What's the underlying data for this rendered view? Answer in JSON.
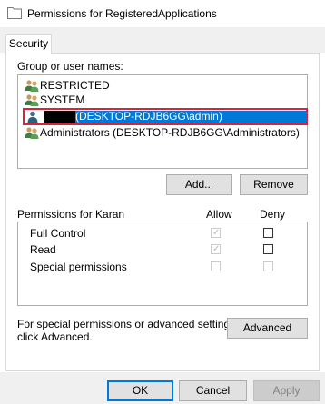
{
  "window": {
    "title": "Permissions for RegisteredApplications"
  },
  "tabs": [
    {
      "label": "Security"
    }
  ],
  "group_section": {
    "label": "Group or user names:",
    "users": [
      {
        "name": "RESTRICTED",
        "icon": "users-icon"
      },
      {
        "name": "SYSTEM",
        "icon": "users-icon"
      },
      {
        "name": "(DESKTOP-RDJB6GG\\admin)",
        "icon": "user-icon",
        "selected": true,
        "name_redacted": true
      },
      {
        "name": "Administrators (DESKTOP-RDJB6GG\\Administrators)",
        "icon": "users-icon"
      }
    ],
    "add_label": "Add...",
    "remove_label": "Remove"
  },
  "permissions_section": {
    "title": "Permissions for Karan",
    "allow_header": "Allow",
    "deny_header": "Deny",
    "rows": [
      {
        "name": "Full Control",
        "allow": true,
        "deny": false,
        "allow_enabled": false,
        "deny_enabled": true
      },
      {
        "name": "Read",
        "allow": true,
        "deny": false,
        "allow_enabled": false,
        "deny_enabled": true
      },
      {
        "name": "Special permissions",
        "allow": false,
        "deny": false,
        "allow_enabled": false,
        "deny_enabled": false
      }
    ]
  },
  "advanced_section": {
    "note_line1": "For special permissions or advanced settings,",
    "note_line2": "click Advanced.",
    "advanced_label": "Advanced"
  },
  "footer": {
    "ok_label": "OK",
    "cancel_label": "Cancel",
    "apply_label": "Apply"
  },
  "colors": {
    "selection": "#0078d7",
    "highlight_border": "#d3263b"
  }
}
